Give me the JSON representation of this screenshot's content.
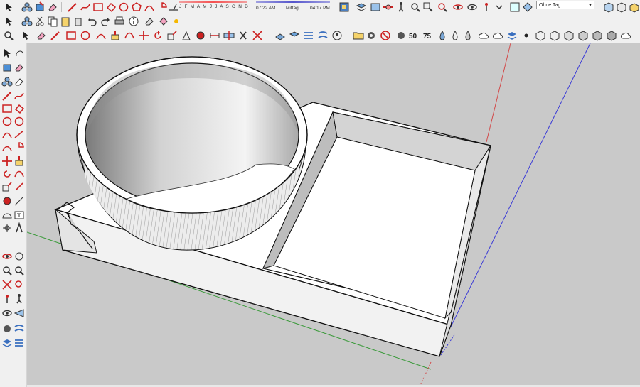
{
  "time_panel": {
    "months": "J F M A M J J A S O N D",
    "sunrise": "07:22 AM",
    "noon": "Mittag",
    "sunset": "04:17 PM"
  },
  "tag_selector": {
    "value": "Ohne Tag"
  },
  "toolbar_icons": [
    "select-icon",
    "paint-icon",
    "component-icon",
    "cut-icon",
    "copy-icon",
    "paste-icon",
    "erase-icon",
    "undo-icon",
    "redo-icon",
    "print-icon",
    "info-icon",
    "eraser-icon",
    "pencil-line-icon",
    "freehand-icon",
    "rectangle-icon",
    "circle-icon",
    "polygon-icon",
    "arc-icon",
    "move-icon",
    "push-pull-icon",
    "rotate-icon",
    "follow-me-icon",
    "scale-icon",
    "offset-icon",
    "tape-measure-icon",
    "dimension-icon",
    "protractor-icon",
    "text-icon",
    "axes-icon",
    "3d-text-icon",
    "orbit-icon",
    "pan-icon",
    "zoom-icon",
    "zoom-window-icon",
    "zoom-extents-icon",
    "walk-icon",
    "look-around-icon",
    "section-plane-icon",
    "sandbox-icon",
    "outliner-icon",
    "folder-icon",
    "gear-icon",
    "no-entry-icon",
    "shaded-icon",
    "xray-icon",
    "monochrome-icon",
    "cloud-upload-icon",
    "cloud-download-icon",
    "iso-view-icon",
    "top-view-icon",
    "front-view-icon",
    "right-view-icon",
    "back-view-icon",
    "left-view-icon"
  ],
  "colors": {
    "axis_red": "#d34a4a",
    "axis_green": "#3a9a3a",
    "axis_blue": "#3b3bd6",
    "viewport_bg": "#c9c9c9",
    "model_face": "#ffffff",
    "model_edge": "#111111"
  }
}
